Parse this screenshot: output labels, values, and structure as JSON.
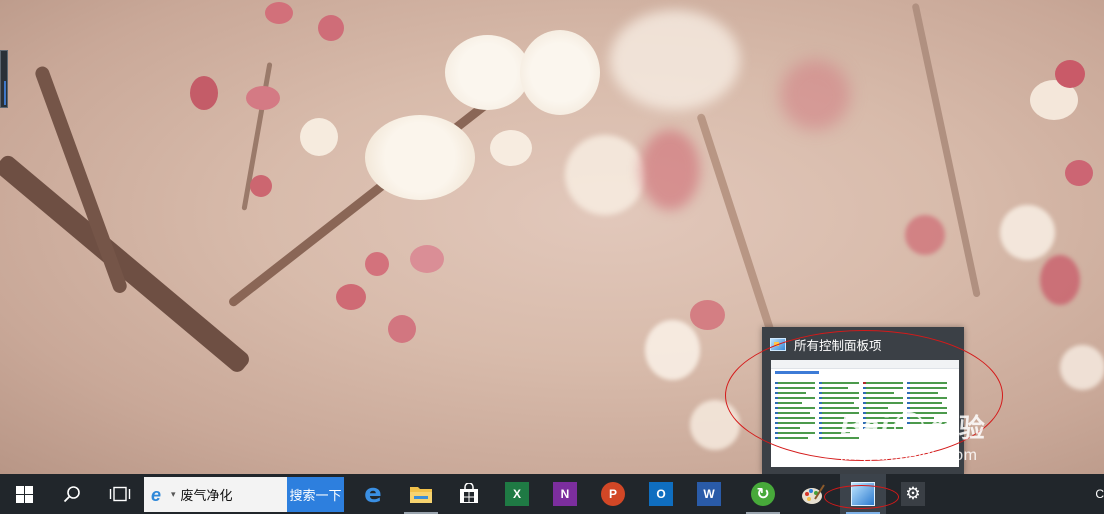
{
  "desktop": {
    "edge_handle": "edge-panel-handle"
  },
  "thumbnail": {
    "title": "所有控制面板项",
    "icon": "control-panel-icon"
  },
  "watermark": {
    "brand": "Bai",
    "brand_cn": "经验",
    "url": "jingyan.baidu.com"
  },
  "taskbar": {
    "start_icon": "windows-start-icon",
    "search_icon": "search-icon",
    "task_view_icon": "task-view-icon",
    "search_box_value": "废气净化",
    "search_box_caret": "▾",
    "search_button_label": "搜索一下",
    "pinned": [
      {
        "name": "edge-icon",
        "glyph": "e"
      },
      {
        "name": "file-explorer-icon",
        "glyph": ""
      },
      {
        "name": "store-icon",
        "glyph": ""
      },
      {
        "name": "excel-icon",
        "glyph": "X"
      },
      {
        "name": "onenote-icon",
        "glyph": "N"
      },
      {
        "name": "powerpoint-icon",
        "glyph": "P"
      },
      {
        "name": "outlook-icon",
        "glyph": "O"
      },
      {
        "name": "word-icon",
        "glyph": "W"
      },
      {
        "name": "refresh-app-icon",
        "glyph": "↻"
      },
      {
        "name": "paint-icon",
        "glyph": ""
      },
      {
        "name": "control-panel-icon",
        "glyph": ""
      },
      {
        "name": "settings-gear-icon",
        "glyph": "⚙"
      }
    ],
    "corner_text": "C"
  },
  "colors": {
    "taskbar": "#21262b",
    "search_button": "#2d7fde",
    "annotation_red": "#d41a1a"
  }
}
